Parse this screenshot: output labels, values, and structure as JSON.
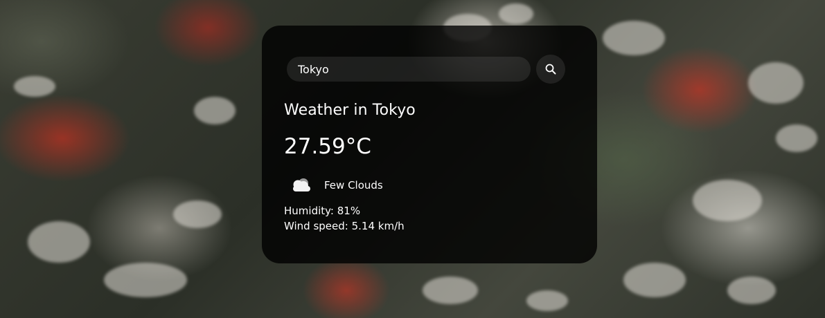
{
  "search": {
    "value": "Tokyo",
    "button_icon": "search-icon"
  },
  "weather": {
    "title": "Weather in Tokyo",
    "temperature": "27.59°C",
    "icon": "cloud-icon",
    "description": "Few Clouds",
    "humidity": "Humidity: 81%",
    "wind": "Wind speed: 5.14 km/h"
  },
  "colors": {
    "card_background": "#000000",
    "text": "#ffffff"
  }
}
